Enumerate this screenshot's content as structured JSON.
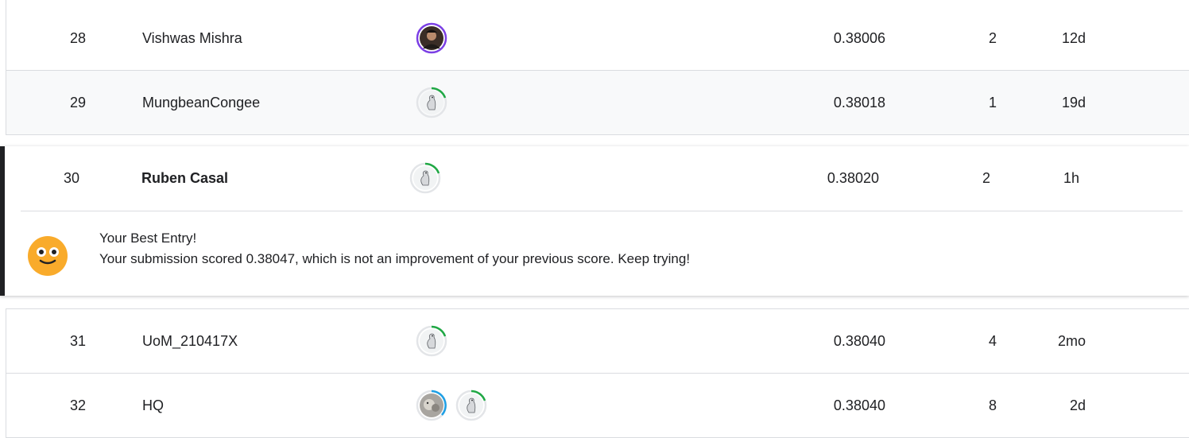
{
  "rows_top": [
    {
      "rank": "28",
      "team": "Vishwas Mishra",
      "score": "0.38006",
      "entries": "2",
      "last": "12d",
      "avatar_icons": [
        "user-photo-icon"
      ],
      "tier_color": "#7b3fe4"
    },
    {
      "rank": "29",
      "team": "MungbeanCongee",
      "score": "0.38018",
      "entries": "1",
      "last": "19d",
      "avatar_icons": [
        "default-goose-avatar-icon"
      ],
      "tier_color": "#20a845"
    }
  ],
  "current_user": {
    "rank": "30",
    "team": "Ruben Casal",
    "score": "0.38020",
    "entries": "2",
    "last": "1h",
    "avatar_icons": [
      "default-goose-avatar-icon"
    ],
    "tier_color": "#20a845",
    "message_title": "Your Best Entry!",
    "message_body": "Your submission scored 0.38047, which is not an improvement of your previous score. Keep trying!",
    "message_icon": "smiley-face-icon"
  },
  "rows_bottom": [
    {
      "rank": "31",
      "team": "UoM_210417X",
      "score": "0.38040",
      "entries": "4",
      "last": "2mo",
      "avatar_icons": [
        "default-goose-avatar-icon"
      ],
      "tier_color": "#20a845"
    },
    {
      "rank": "32",
      "team": "HQ",
      "score": "0.38040",
      "entries": "8",
      "last": "2d",
      "avatar_icons": [
        "user-photo-icon",
        "default-goose-avatar-icon"
      ],
      "tier_color": "#20a845",
      "second_tier_color": "#1ea0e6"
    }
  ],
  "colors": {
    "novice_ring": "#20a845",
    "expert_ring": "#7b3fe4",
    "contributor_ring": "#1ea0e6",
    "highlight_bar": "#202124",
    "smiley": "#f9ab2b"
  }
}
